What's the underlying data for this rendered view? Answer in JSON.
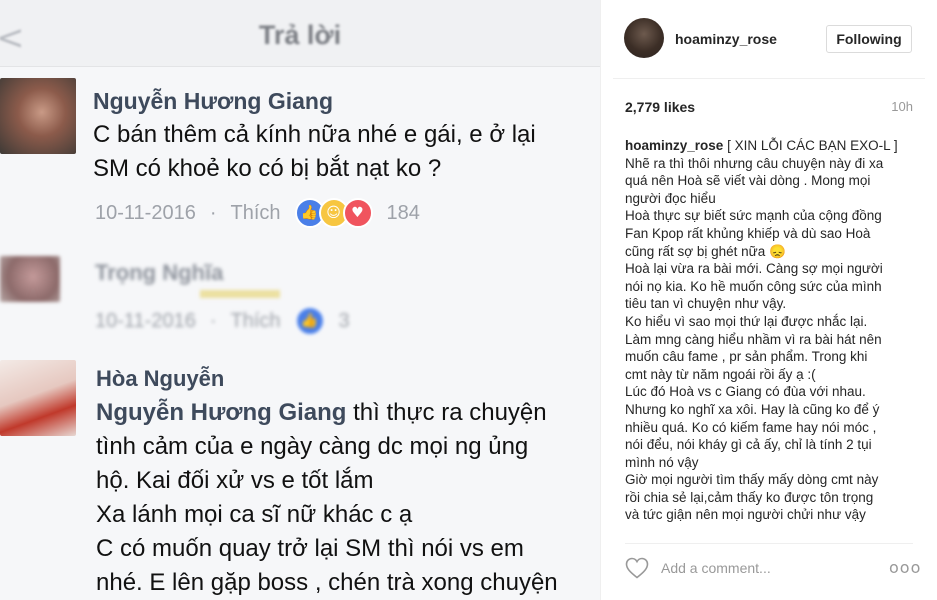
{
  "photo": {
    "bar_title": "Trả lời",
    "back_glyph": "<",
    "comments": [
      {
        "name": "Nguyễn Hương Giang",
        "text": "C bán thêm cả kính nữa nhé e gái, e ở lại\nSM có khoẻ ko có bị bắt nạt ko ?",
        "date": "10-11-2016",
        "like_label": "Thích",
        "reactions": [
          "like-icon",
          "haha-icon",
          "love-icon"
        ],
        "count": "184"
      },
      {
        "name": "Trọng Nghĩa",
        "text": "",
        "date": "10-11-2016",
        "like_label": "Thích",
        "reactions": [
          "like-icon"
        ],
        "count": "3"
      },
      {
        "name": "Hòa Nguyễn",
        "mention": "Nguyễn Hương Giang",
        "text_first": " thì thực ra chuyện",
        "text": "tình cảm của e ngày càng dc mọi ng ủng\nhộ. Kai đối xử vs e tốt lắm\nXa lánh mọi ca sĩ nữ khác c ạ\nC có muốn quay trở lại SM thì nói vs em\nnhé. E lên gặp boss , chén trà xong chuyện"
      }
    ],
    "colors": {
      "like": "#4a7fe8",
      "love": "#f0545e",
      "haha": "#f7c641"
    }
  },
  "post": {
    "username": "hoaminzy_rose",
    "follow_label": "Following",
    "likes": "2,779 likes",
    "time": "10h",
    "caption_title": "[ XIN LỖI CÁC BẠN EXO-L ]",
    "caption_lines": [
      "Nhẽ ra thì thôi nhưng câu chuyện này đi xa",
      "quá nên Hoà sẽ viết vài dòng . Mong mọi",
      "người đọc hiểu",
      "Hoà thực sự biết sức mạnh của cộng đồng",
      "Fan Kpop rất khủng khiếp và dù sao Hoà",
      "cũng rất sợ bị ghét nữa 😞",
      "Hoà lại vừa ra bài mới. Càng sợ mọi người",
      "nói nọ kia. Ko hề muốn công sức của mình",
      "tiêu tan vì chuyện như vậy.",
      "Ko hiểu vì sao mọi thứ lại được nhắc lại.",
      "Làm mng càng hiểu nhầm vì ra bài hát nên",
      "muốn câu fame , pr sản phẩm. Trong khi",
      "cmt này từ năm ngoái rồi ấy ạ :(",
      "Lúc đó Hoà vs c Giang có đùa với nhau.",
      "Nhưng ko nghĩ xa xôi. Hay là cũng ko để ý",
      "nhiều quá. Ko có kiếm fame hay nói móc ,",
      "nói đểu, nói kháy gì cả ấy, chỉ là tính 2 tụi",
      "mình nó vậy",
      "Giờ mọi người tìm thấy mấy dòng cmt này",
      "rồi chia sẻ lại,cảm thấy ko được tôn trọng",
      "và tức giận nên mọi người chửi như vậy"
    ],
    "add_comment_placeholder": "Add a comment...",
    "more_glyph": "ooo"
  }
}
